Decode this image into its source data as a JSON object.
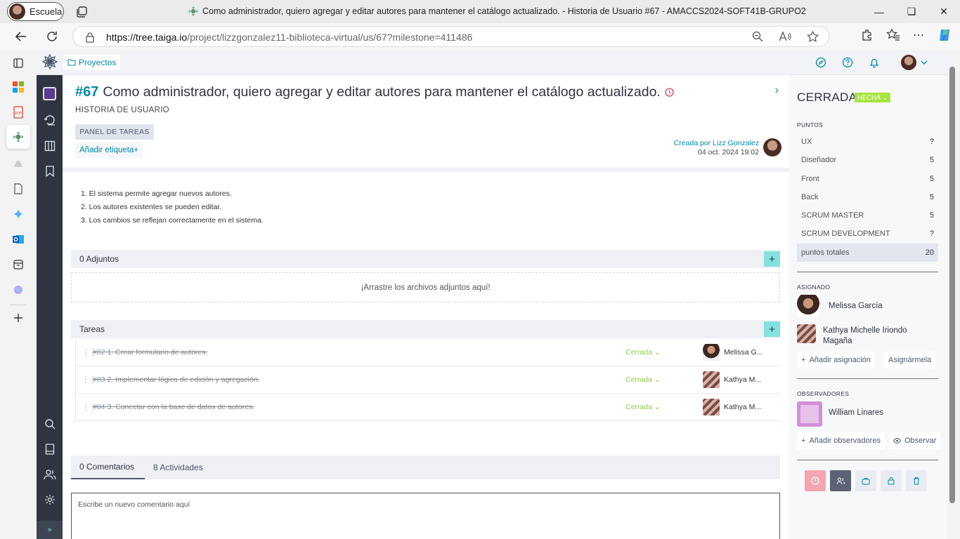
{
  "browser": {
    "profile_label": "Escuela",
    "window_title": "Como administrador, quiero agregar y editar autores para mantener el catálogo actualizado. - Historia de Usuario #67 - AMACCS2024-SOFT41B-GRUPO2",
    "url_host": "https://tree.taiga.io",
    "url_path": "/project/lizzgonzalez11-biblioteca-virtual/us/67?milestone=411486"
  },
  "taiga": {
    "breadcrumb": "Proyectos"
  },
  "story": {
    "ref": "#67",
    "title": "Como administrador, quiero agregar y editar autores para mantener el catálogo actualizado.",
    "type": "HISTORIA DE USUARIO",
    "task_panel": "PANEL DE TAREAS",
    "add_tag": "Añadir etiqueta",
    "created_by": "Creada por Lizz Gonzalez",
    "created_date": "04 oct. 2024 19:02",
    "description": [
      "1. El sistema permite agregar nuevos autores.",
      "2. Los autores existentes se pueden editar.",
      "3. Los cambios se reflejan correctamente en el sistema."
    ]
  },
  "attachments": {
    "header": "0 Adjuntos",
    "dropzone": "¡Arrastre los archivos adjuntos aquí!"
  },
  "tasks": {
    "header": "Tareas",
    "items": [
      {
        "ref": "#82",
        "text": "1. Crear formulario de autores.",
        "status": "Cerrada",
        "assignee": "Melissa G..."
      },
      {
        "ref": "#83",
        "text": "2. Implementar lógica de edición y agregación.",
        "status": "Cerrada",
        "assignee": "Kathya M..."
      },
      {
        "ref": "#84",
        "text": "3. Conectar con la base de datos de autores.",
        "status": "Cerrada",
        "assignee": "Kathya M..."
      }
    ]
  },
  "activity": {
    "tab_comments": "0 Comentarios",
    "tab_activities": "8 Actividades",
    "comment_placeholder": "Escribe un nuevo comentario aquí"
  },
  "sidebar": {
    "status": "CERRADA",
    "status_badge": "HECHA",
    "points_label": "PUNTOS",
    "points": [
      {
        "name": "UX",
        "value": "?"
      },
      {
        "name": "Diseñador",
        "value": "5"
      },
      {
        "name": "Front",
        "value": "5"
      },
      {
        "name": "Back",
        "value": "5"
      },
      {
        "name": "SCRUM MASTER",
        "value": "5"
      },
      {
        "name": "SCRUM DEVELOPMENT",
        "value": "?"
      }
    ],
    "total_label": "puntos totales",
    "total_value": "20",
    "assigned_label": "ASIGNADO",
    "assigned": [
      "Melissa García",
      "Kathya Michelle Iriondo Magaña"
    ],
    "add_assign": "Añadir asignación",
    "assign_me": "Asignármela",
    "watchers_label": "OBSERVADORES",
    "watchers": [
      "William Linares"
    ],
    "add_watchers": "Añadir observadores",
    "watch": "Observar"
  },
  "colors": {
    "accent": "#008aa8",
    "plus_button": "#83e2e0",
    "status_done": "#a8e440",
    "task_closed": "#93c94a",
    "clock_red": "#e44057"
  }
}
